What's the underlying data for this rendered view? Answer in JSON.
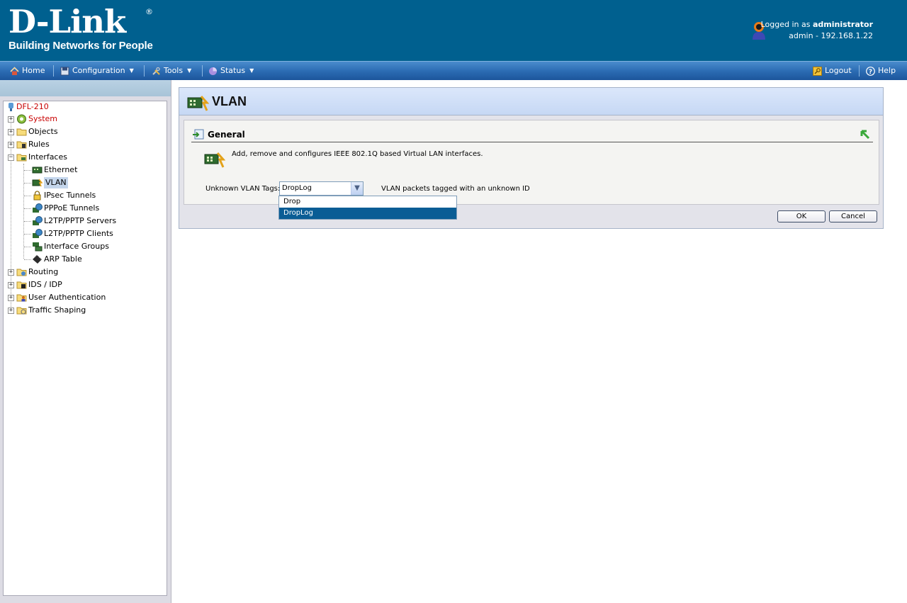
{
  "header": {
    "brand": "D-Link",
    "brand_mark": "®",
    "tagline": "Building Networks for People",
    "logged_in_prefix": "Logged in as",
    "username": "administrator",
    "session": "admin - 192.168.1.22"
  },
  "menubar": {
    "home": "Home",
    "configuration": "Configuration",
    "tools": "Tools",
    "status": "Status",
    "logout": "Logout",
    "help": "Help"
  },
  "tree": {
    "root": "DFL-210",
    "system": "System",
    "objects": "Objects",
    "rules": "Rules",
    "interfaces": "Interfaces",
    "ethernet": "Ethernet",
    "vlan": "VLAN",
    "ipsec": "IPsec Tunnels",
    "pppoe": "PPPoE Tunnels",
    "l2tp_servers": "L2TP/PPTP Servers",
    "l2tp_clients": "L2TP/PPTP Clients",
    "interface_groups": "Interface Groups",
    "arp_table": "ARP Table",
    "routing": "Routing",
    "ids_idp": "IDS / IDP",
    "user_auth": "User Authentication",
    "traffic_shaping": "Traffic Shaping",
    "expand_symbol": "+",
    "collapse_symbol": "−"
  },
  "content": {
    "title": "VLAN",
    "section_title": "General",
    "description": "Add, remove and configures IEEE 802.1Q based Virtual LAN interfaces.",
    "unknown_tags_label": "Unknown VLAN Tags:",
    "unknown_tags_value": "DropLog",
    "unknown_tags_help": "VLAN packets tagged with an unknown ID",
    "options": [
      "Drop",
      "DropLog"
    ],
    "ok_label": "OK",
    "cancel_label": "Cancel"
  },
  "colors": {
    "header_bg": "#00608f",
    "selected_option": "#0a5d95",
    "tree_red": "#c80000"
  }
}
